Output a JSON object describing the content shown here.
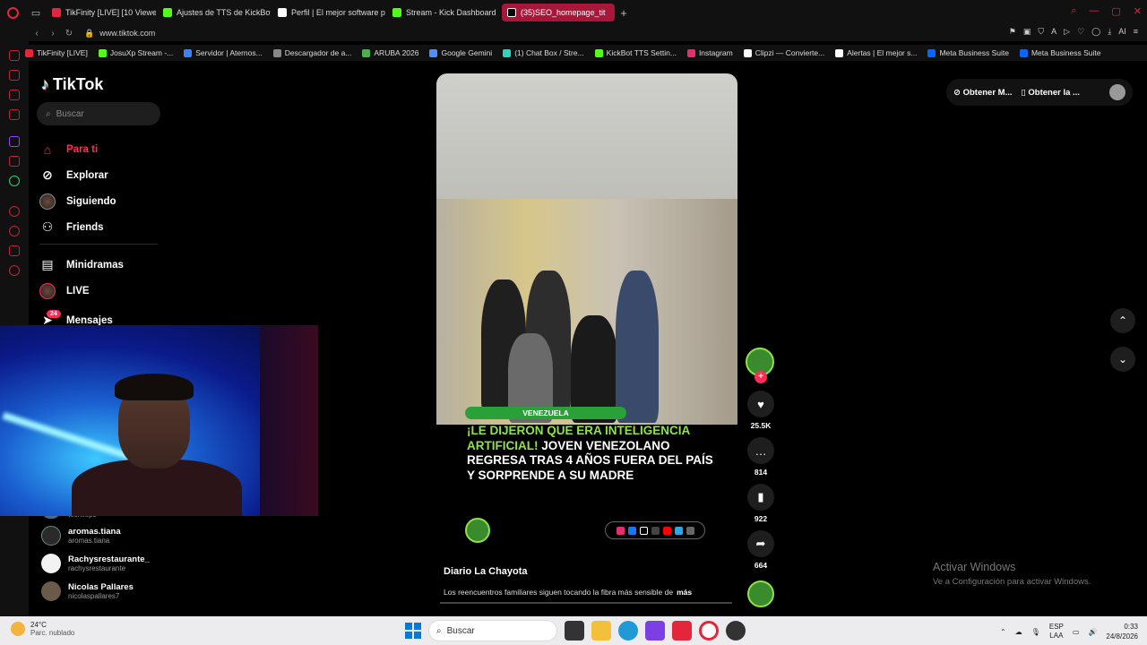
{
  "browser": {
    "tabs": [
      {
        "label": "TikFinity [LIVE] [10 Viewers",
        "color": "#e3263c",
        "active": false
      },
      {
        "label": "Ajustes de TTS de KickBot",
        "color": "#53fc18",
        "active": false
      },
      {
        "label": "Perfil | El mejor software p",
        "color": "#ffffff",
        "active": false
      },
      {
        "label": "Stream - Kick Dashboard",
        "color": "#53fc18",
        "active": false
      },
      {
        "label": "(35)SEO_homepage_tit",
        "color": "#000000",
        "active": true
      }
    ],
    "url": "www.tiktok.com",
    "bookmarks": [
      {
        "label": "TikFinity [LIVE]",
        "color": "#e3263c"
      },
      {
        "label": "JosuXp Stream -...",
        "color": "#53fc18"
      },
      {
        "label": "Servidor | Aternos...",
        "color": "#3b82f6"
      },
      {
        "label": "Descargador de a...",
        "color": "#888888"
      },
      {
        "label": "ARUBA 2026",
        "color": "#4caf50"
      },
      {
        "label": "Google Gemini",
        "color": "#4f8ef7"
      },
      {
        "label": "(1) Chat Box / Stre...",
        "color": "#2dd4bf"
      },
      {
        "label": "KickBot TTS Settin...",
        "color": "#53fc18"
      },
      {
        "label": "Instagram",
        "color": "#e1306c"
      },
      {
        "label": "Clipzi — Convierte...",
        "color": "#ffffff"
      },
      {
        "label": "Alertas | El mejor s...",
        "color": "#ffffff"
      },
      {
        "label": "Meta Business Suite",
        "color": "#0866ff"
      },
      {
        "label": "Meta Business Suite",
        "color": "#0866ff"
      }
    ]
  },
  "tiktok": {
    "logo": "TikTok",
    "search_placeholder": "Buscar",
    "menu": [
      {
        "label": "Para ti",
        "icon": "home-icon"
      },
      {
        "label": "Explorar",
        "icon": "compass-icon"
      },
      {
        "label": "Siguiendo",
        "icon": "avatar-icon"
      },
      {
        "label": "Friends",
        "icon": "friends-icon"
      },
      {
        "label": "Minidramas",
        "icon": "film-icon"
      },
      {
        "label": "LIVE",
        "icon": "live-icon"
      },
      {
        "label": "Mensajes",
        "icon": "send-icon"
      }
    ],
    "messages_badge": "24",
    "following": [
      {
        "name": "",
        "handle": "tecnileps"
      },
      {
        "name": "aromas.tiana",
        "handle": "aromas.tiana"
      },
      {
        "name": "Rachysrestaurante_",
        "handle": "rachysrestaurante"
      },
      {
        "name": "Nicolas Pallares",
        "handle": "nicolaspallares7"
      }
    ],
    "top_buttons": [
      "Obtener M...",
      "Obtener la ..."
    ],
    "video": {
      "tag": "VENEZUELA",
      "headline_green": "¡LE DIJERON QUE ERA INTELIGENCIA ARTIFICIAL!",
      "headline_white": " JOVEN VENEZOLANO REGRESA TRAS 4 AÑOS FUERA DEL PAÍS Y SORPRENDE A SU MADRE",
      "author": "Diario La Chayota",
      "caption": "Los reencuentros familiares siguen tocando la fibra más sensible de",
      "more": "más"
    },
    "actions": {
      "likes": "25.5K",
      "comments": "814",
      "saves": "922",
      "shares": "664"
    }
  },
  "watermark": {
    "line1": "Activar Windows",
    "line2": "Ve a Configuración para activar Windows."
  },
  "taskbar": {
    "temp": "24°C",
    "weather": "Parc. nublado",
    "search": "Buscar",
    "lang1": "ESP",
    "lang2": "LAA",
    "time": "0:33",
    "date": "24/8/2026"
  }
}
